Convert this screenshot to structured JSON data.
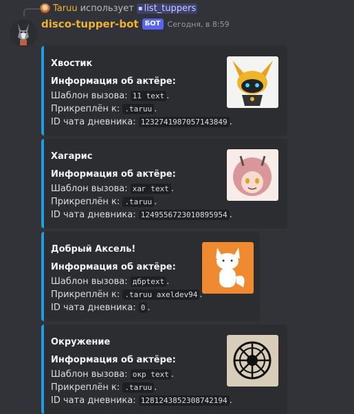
{
  "reply": {
    "user": "Taruu",
    "action": "использует",
    "command": "list_tuppers"
  },
  "message": {
    "bot_name": "disco-tupper-bot",
    "badge": "БОТ",
    "timestamp": "Сегодня, в 8:59"
  },
  "colors": {
    "accent": "#1e9ee0",
    "bot_name": "#f0b232",
    "badge": "#5865f2"
  },
  "embeds": [
    {
      "title": "Хвостик",
      "field_title": "Информация об актёре:",
      "template_label": "Шаблон вызова:",
      "template": "11 text",
      "attached_label": "Прикреплён к:",
      "attached": ".taruu",
      "chat_label": "ID чата дневника:",
      "chat_id": "1232741987057143849",
      "thumbnail": "yellow-robot-fox-icon"
    },
    {
      "title": "Хагарис",
      "field_title": "Информация об актёре:",
      "template_label": "Шаблон вызова:",
      "template": "хаг text",
      "attached_label": "Прикреплён к:",
      "attached": ".taruu",
      "chat_label": "ID чата дневника:",
      "chat_id": "1249556723010895954",
      "thumbnail": "pink-haired-horned-character-icon"
    },
    {
      "title": "Добрый Аксель!",
      "field_title": "Информация об актёре:",
      "template_label": "Шаблон вызова:",
      "template": "дбрtext",
      "attached_label": "Прикреплён к:",
      "attached": ".taruu axeldev94",
      "chat_label": "ID чата дневника:",
      "chat_id": "0",
      "thumbnail": "white-fox-on-orange-icon"
    },
    {
      "title": "Окружение",
      "field_title": "Информация об актёре:",
      "template_label": "Шаблон вызова:",
      "template": "окр text",
      "attached_label": "Прикреплён к:",
      "attached": ".taruu",
      "chat_label": "ID чата дневника:",
      "chat_id": "1281243852308742194",
      "thumbnail": "black-sketch-globe-icon"
    }
  ]
}
